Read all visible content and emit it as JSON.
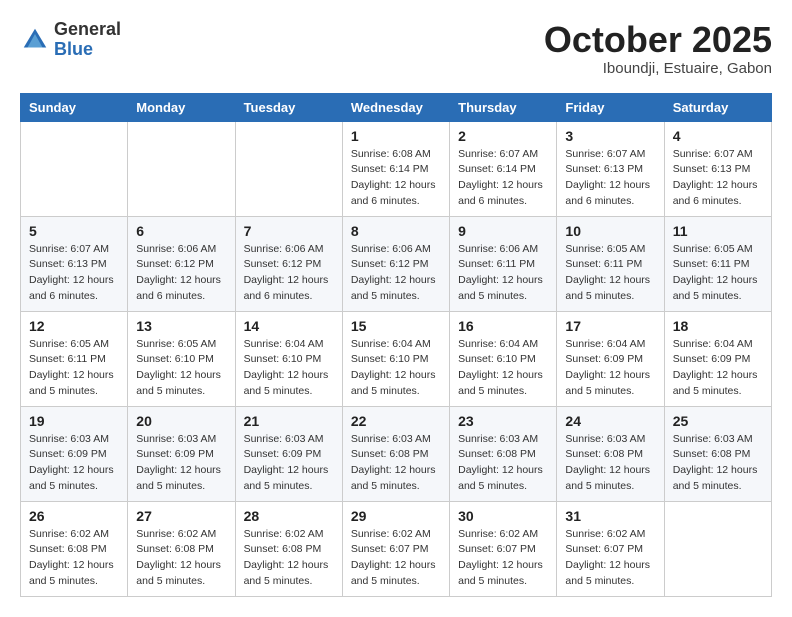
{
  "logo": {
    "general": "General",
    "blue": "Blue"
  },
  "header": {
    "month": "October 2025",
    "location": "Iboundji, Estuaire, Gabon"
  },
  "weekdays": [
    "Sunday",
    "Monday",
    "Tuesday",
    "Wednesday",
    "Thursday",
    "Friday",
    "Saturday"
  ],
  "weeks": [
    [
      {
        "day": "",
        "info": ""
      },
      {
        "day": "",
        "info": ""
      },
      {
        "day": "",
        "info": ""
      },
      {
        "day": "1",
        "info": "Sunrise: 6:08 AM\nSunset: 6:14 PM\nDaylight: 12 hours and 6 minutes."
      },
      {
        "day": "2",
        "info": "Sunrise: 6:07 AM\nSunset: 6:14 PM\nDaylight: 12 hours and 6 minutes."
      },
      {
        "day": "3",
        "info": "Sunrise: 6:07 AM\nSunset: 6:13 PM\nDaylight: 12 hours and 6 minutes."
      },
      {
        "day": "4",
        "info": "Sunrise: 6:07 AM\nSunset: 6:13 PM\nDaylight: 12 hours and 6 minutes."
      }
    ],
    [
      {
        "day": "5",
        "info": "Sunrise: 6:07 AM\nSunset: 6:13 PM\nDaylight: 12 hours and 6 minutes."
      },
      {
        "day": "6",
        "info": "Sunrise: 6:06 AM\nSunset: 6:12 PM\nDaylight: 12 hours and 6 minutes."
      },
      {
        "day": "7",
        "info": "Sunrise: 6:06 AM\nSunset: 6:12 PM\nDaylight: 12 hours and 6 minutes."
      },
      {
        "day": "8",
        "info": "Sunrise: 6:06 AM\nSunset: 6:12 PM\nDaylight: 12 hours and 5 minutes."
      },
      {
        "day": "9",
        "info": "Sunrise: 6:06 AM\nSunset: 6:11 PM\nDaylight: 12 hours and 5 minutes."
      },
      {
        "day": "10",
        "info": "Sunrise: 6:05 AM\nSunset: 6:11 PM\nDaylight: 12 hours and 5 minutes."
      },
      {
        "day": "11",
        "info": "Sunrise: 6:05 AM\nSunset: 6:11 PM\nDaylight: 12 hours and 5 minutes."
      }
    ],
    [
      {
        "day": "12",
        "info": "Sunrise: 6:05 AM\nSunset: 6:11 PM\nDaylight: 12 hours and 5 minutes."
      },
      {
        "day": "13",
        "info": "Sunrise: 6:05 AM\nSunset: 6:10 PM\nDaylight: 12 hours and 5 minutes."
      },
      {
        "day": "14",
        "info": "Sunrise: 6:04 AM\nSunset: 6:10 PM\nDaylight: 12 hours and 5 minutes."
      },
      {
        "day": "15",
        "info": "Sunrise: 6:04 AM\nSunset: 6:10 PM\nDaylight: 12 hours and 5 minutes."
      },
      {
        "day": "16",
        "info": "Sunrise: 6:04 AM\nSunset: 6:10 PM\nDaylight: 12 hours and 5 minutes."
      },
      {
        "day": "17",
        "info": "Sunrise: 6:04 AM\nSunset: 6:09 PM\nDaylight: 12 hours and 5 minutes."
      },
      {
        "day": "18",
        "info": "Sunrise: 6:04 AM\nSunset: 6:09 PM\nDaylight: 12 hours and 5 minutes."
      }
    ],
    [
      {
        "day": "19",
        "info": "Sunrise: 6:03 AM\nSunset: 6:09 PM\nDaylight: 12 hours and 5 minutes."
      },
      {
        "day": "20",
        "info": "Sunrise: 6:03 AM\nSunset: 6:09 PM\nDaylight: 12 hours and 5 minutes."
      },
      {
        "day": "21",
        "info": "Sunrise: 6:03 AM\nSunset: 6:09 PM\nDaylight: 12 hours and 5 minutes."
      },
      {
        "day": "22",
        "info": "Sunrise: 6:03 AM\nSunset: 6:08 PM\nDaylight: 12 hours and 5 minutes."
      },
      {
        "day": "23",
        "info": "Sunrise: 6:03 AM\nSunset: 6:08 PM\nDaylight: 12 hours and 5 minutes."
      },
      {
        "day": "24",
        "info": "Sunrise: 6:03 AM\nSunset: 6:08 PM\nDaylight: 12 hours and 5 minutes."
      },
      {
        "day": "25",
        "info": "Sunrise: 6:03 AM\nSunset: 6:08 PM\nDaylight: 12 hours and 5 minutes."
      }
    ],
    [
      {
        "day": "26",
        "info": "Sunrise: 6:02 AM\nSunset: 6:08 PM\nDaylight: 12 hours and 5 minutes."
      },
      {
        "day": "27",
        "info": "Sunrise: 6:02 AM\nSunset: 6:08 PM\nDaylight: 12 hours and 5 minutes."
      },
      {
        "day": "28",
        "info": "Sunrise: 6:02 AM\nSunset: 6:08 PM\nDaylight: 12 hours and 5 minutes."
      },
      {
        "day": "29",
        "info": "Sunrise: 6:02 AM\nSunset: 6:07 PM\nDaylight: 12 hours and 5 minutes."
      },
      {
        "day": "30",
        "info": "Sunrise: 6:02 AM\nSunset: 6:07 PM\nDaylight: 12 hours and 5 minutes."
      },
      {
        "day": "31",
        "info": "Sunrise: 6:02 AM\nSunset: 6:07 PM\nDaylight: 12 hours and 5 minutes."
      },
      {
        "day": "",
        "info": ""
      }
    ]
  ]
}
